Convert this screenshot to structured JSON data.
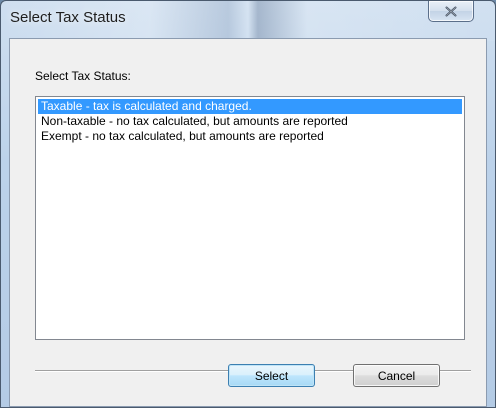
{
  "window": {
    "title": "Select Tax Status"
  },
  "dialog": {
    "prompt_label": "Select Tax Status:",
    "options": [
      {
        "label": "Taxable - tax is calculated and charged.",
        "selected": true
      },
      {
        "label": "Non-taxable - no tax calculated, but amounts are reported",
        "selected": false
      },
      {
        "label": "Exempt - no tax calculated, but amounts are reported",
        "selected": false
      }
    ]
  },
  "buttons": {
    "select_label": "Select",
    "cancel_label": "Cancel"
  },
  "icons": {
    "close": "close-icon"
  },
  "colors": {
    "selection": "#3399ff",
    "selection_text": "#ffffff"
  }
}
